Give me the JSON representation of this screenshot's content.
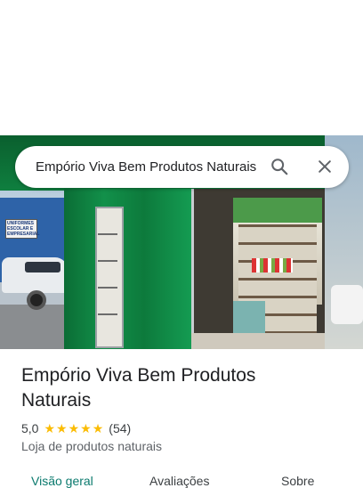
{
  "search": {
    "query": "Empório Viva Bem Produtos Naturais"
  },
  "photo": {
    "sign_text": "UNIFORMES ESCOLAR E EMPRESARIAL"
  },
  "place": {
    "name": "Empório Viva Bem Produtos Naturais",
    "rating": "5,0",
    "stars": 5,
    "review_count": "(54)",
    "category": "Loja de produtos naturais"
  },
  "tabs": [
    {
      "label": "Visão geral",
      "active": true
    },
    {
      "label": "Avaliações",
      "active": false
    },
    {
      "label": "Sobre",
      "active": false
    }
  ],
  "colors": {
    "accent": "#0b7a6e",
    "star": "#fbbc04",
    "store_green": "#0f7f3f"
  },
  "icons": [
    "search-icon",
    "close-icon",
    "star-icon"
  ]
}
